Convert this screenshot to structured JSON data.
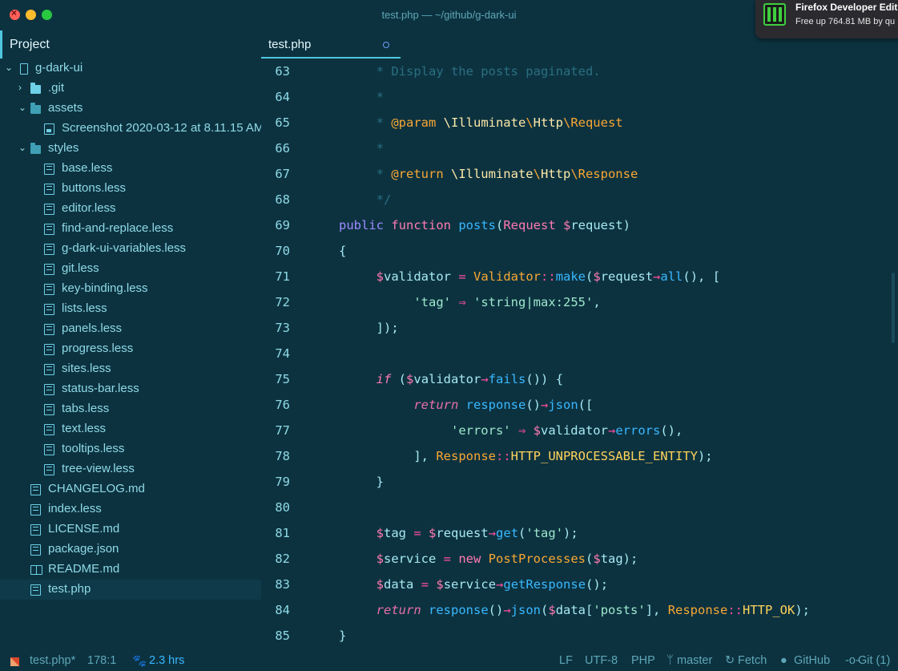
{
  "window": {
    "title": "test.php — ~/github/g-dark-ui"
  },
  "notification": {
    "title": "Firefox Developer Edit",
    "body": "Free up 764.81 MB by qu"
  },
  "sidebar": {
    "panel_title": "Project",
    "tree": [
      {
        "label": "g-dark-ui",
        "icon": "repo-icon",
        "arrow": "⌄",
        "depth": 0
      },
      {
        "label": ".git",
        "icon": "folder-icon",
        "arrow": "›",
        "depth": 1
      },
      {
        "label": "assets",
        "icon": "folder-open-icon",
        "arrow": "⌄",
        "depth": 1
      },
      {
        "label": "Screenshot 2020-03-12 at 8.11.15 AM",
        "icon": "image-icon",
        "arrow": "",
        "depth": 2
      },
      {
        "label": "styles",
        "icon": "folder-open-icon",
        "arrow": "⌄",
        "depth": 1
      },
      {
        "label": "base.less",
        "icon": "file-icon",
        "arrow": "",
        "depth": 2
      },
      {
        "label": "buttons.less",
        "icon": "file-icon",
        "arrow": "",
        "depth": 2
      },
      {
        "label": "editor.less",
        "icon": "file-icon",
        "arrow": "",
        "depth": 2
      },
      {
        "label": "find-and-replace.less",
        "icon": "file-icon",
        "arrow": "",
        "depth": 2
      },
      {
        "label": "g-dark-ui-variables.less",
        "icon": "file-icon",
        "arrow": "",
        "depth": 2
      },
      {
        "label": "git.less",
        "icon": "file-icon",
        "arrow": "",
        "depth": 2
      },
      {
        "label": "key-binding.less",
        "icon": "file-icon",
        "arrow": "",
        "depth": 2
      },
      {
        "label": "lists.less",
        "icon": "file-icon",
        "arrow": "",
        "depth": 2
      },
      {
        "label": "panels.less",
        "icon": "file-icon",
        "arrow": "",
        "depth": 2
      },
      {
        "label": "progress.less",
        "icon": "file-icon",
        "arrow": "",
        "depth": 2
      },
      {
        "label": "sites.less",
        "icon": "file-icon",
        "arrow": "",
        "depth": 2
      },
      {
        "label": "status-bar.less",
        "icon": "file-icon",
        "arrow": "",
        "depth": 2
      },
      {
        "label": "tabs.less",
        "icon": "file-icon",
        "arrow": "",
        "depth": 2
      },
      {
        "label": "text.less",
        "icon": "file-icon",
        "arrow": "",
        "depth": 2
      },
      {
        "label": "tooltips.less",
        "icon": "file-icon",
        "arrow": "",
        "depth": 2
      },
      {
        "label": "tree-view.less",
        "icon": "file-icon",
        "arrow": "",
        "depth": 2
      },
      {
        "label": "CHANGELOG.md",
        "icon": "file-icon",
        "arrow": "",
        "depth": 1
      },
      {
        "label": "index.less",
        "icon": "file-icon",
        "arrow": "",
        "depth": 1
      },
      {
        "label": "LICENSE.md",
        "icon": "file-icon",
        "arrow": "",
        "depth": 1
      },
      {
        "label": "package.json",
        "icon": "file-icon",
        "arrow": "",
        "depth": 1
      },
      {
        "label": "README.md",
        "icon": "book-icon",
        "arrow": "",
        "depth": 1
      },
      {
        "label": "test.php",
        "icon": "file-icon",
        "arrow": "",
        "depth": 1,
        "selected": true
      }
    ]
  },
  "tabs": [
    {
      "label": "test.php",
      "modified": true
    }
  ],
  "editor": {
    "lines": [
      {
        "n": "63",
        "tokens": [
          [
            "c-com",
            "     * Display the posts paginated."
          ]
        ]
      },
      {
        "n": "64",
        "tokens": [
          [
            "c-com",
            "     *"
          ]
        ]
      },
      {
        "n": "65",
        "tokens": [
          [
            "c-com",
            "     * "
          ],
          [
            "c-ann",
            "@param "
          ],
          [
            "c-ns",
            "\\Illuminate"
          ],
          [
            "c-cls",
            "\\"
          ],
          [
            "c-ns",
            "Http"
          ],
          [
            "c-cls",
            "\\Request"
          ]
        ]
      },
      {
        "n": "66",
        "tokens": [
          [
            "c-com",
            "     *"
          ]
        ]
      },
      {
        "n": "67",
        "tokens": [
          [
            "c-com",
            "     * "
          ],
          [
            "c-ann",
            "@return "
          ],
          [
            "c-ns",
            "\\Illuminate"
          ],
          [
            "c-cls",
            "\\"
          ],
          [
            "c-ns",
            "Http"
          ],
          [
            "c-cls",
            "\\Response"
          ]
        ]
      },
      {
        "n": "68",
        "tokens": [
          [
            "c-com",
            "     */"
          ]
        ]
      },
      {
        "n": "69",
        "tokens": [
          [
            "c-pub",
            "public "
          ],
          [
            "c-kw",
            "function "
          ],
          [
            "c-fn",
            "posts"
          ],
          [
            "c-txt",
            "("
          ],
          [
            "c-kw",
            "Request "
          ],
          [
            "c-var",
            "$"
          ],
          [
            "c-txt",
            "request)"
          ]
        ]
      },
      {
        "n": "70",
        "tokens": [
          [
            "c-txt",
            "{"
          ]
        ]
      },
      {
        "n": "71",
        "tokens": [
          [
            "c-txt",
            "     "
          ],
          [
            "c-var",
            "$"
          ],
          [
            "c-txt",
            "validator "
          ],
          [
            "c-op",
            "= "
          ],
          [
            "c-cls",
            "Validator"
          ],
          [
            "c-op",
            "::"
          ],
          [
            "c-fn",
            "make"
          ],
          [
            "c-txt",
            "("
          ],
          [
            "c-var",
            "$"
          ],
          [
            "c-txt",
            "request"
          ],
          [
            "c-op",
            "→"
          ],
          [
            "c-fn",
            "all"
          ],
          [
            "c-txt",
            "(), ["
          ]
        ]
      },
      {
        "n": "72",
        "tokens": [
          [
            "c-txt",
            "          "
          ],
          [
            "c-str",
            "'tag'"
          ],
          [
            "c-op",
            " ⇒ "
          ],
          [
            "c-str",
            "'string|max:255'"
          ],
          [
            "c-txt",
            ","
          ]
        ]
      },
      {
        "n": "73",
        "tokens": [
          [
            "c-txt",
            "     ]);"
          ]
        ]
      },
      {
        "n": "74",
        "tokens": []
      },
      {
        "n": "75",
        "tokens": [
          [
            "c-txt",
            "     "
          ],
          [
            "c-kw c-ital",
            "if "
          ],
          [
            "c-txt",
            "("
          ],
          [
            "c-var",
            "$"
          ],
          [
            "c-txt",
            "validator"
          ],
          [
            "c-op",
            "→"
          ],
          [
            "c-fn",
            "fails"
          ],
          [
            "c-txt",
            "()) {"
          ]
        ]
      },
      {
        "n": "76",
        "tokens": [
          [
            "c-txt",
            "          "
          ],
          [
            "c-kw2 c-ital",
            "return "
          ],
          [
            "c-fn",
            "response"
          ],
          [
            "c-txt",
            "()"
          ],
          [
            "c-op",
            "→"
          ],
          [
            "c-fn",
            "json"
          ],
          [
            "c-txt",
            "(["
          ]
        ]
      },
      {
        "n": "77",
        "tokens": [
          [
            "c-txt",
            "               "
          ],
          [
            "c-str",
            "'errors'"
          ],
          [
            "c-op",
            " ⇒ "
          ],
          [
            "c-var",
            "$"
          ],
          [
            "c-txt",
            "validator"
          ],
          [
            "c-op",
            "→"
          ],
          [
            "c-fn",
            "errors"
          ],
          [
            "c-txt",
            "(),"
          ]
        ]
      },
      {
        "n": "78",
        "tokens": [
          [
            "c-txt",
            "          ], "
          ],
          [
            "c-cls",
            "Response"
          ],
          [
            "c-op",
            "::"
          ],
          [
            "c-yel",
            "HTTP_UNPROCESSABLE_ENTITY"
          ],
          [
            "c-txt",
            ");"
          ]
        ]
      },
      {
        "n": "79",
        "tokens": [
          [
            "c-txt",
            "     }"
          ]
        ]
      },
      {
        "n": "80",
        "tokens": []
      },
      {
        "n": "81",
        "tokens": [
          [
            "c-txt",
            "     "
          ],
          [
            "c-var",
            "$"
          ],
          [
            "c-txt",
            "tag "
          ],
          [
            "c-op",
            "= "
          ],
          [
            "c-var",
            "$"
          ],
          [
            "c-txt",
            "request"
          ],
          [
            "c-op",
            "→"
          ],
          [
            "c-fn",
            "get"
          ],
          [
            "c-txt",
            "("
          ],
          [
            "c-str",
            "'tag'"
          ],
          [
            "c-txt",
            ");"
          ]
        ]
      },
      {
        "n": "82",
        "tokens": [
          [
            "c-txt",
            "     "
          ],
          [
            "c-var",
            "$"
          ],
          [
            "c-txt",
            "service "
          ],
          [
            "c-op",
            "= "
          ],
          [
            "c-kw",
            "new "
          ],
          [
            "c-cls",
            "PostProcesses"
          ],
          [
            "c-txt",
            "("
          ],
          [
            "c-var",
            "$"
          ],
          [
            "c-txt",
            "tag);"
          ]
        ]
      },
      {
        "n": "83",
        "tokens": [
          [
            "c-txt",
            "     "
          ],
          [
            "c-var",
            "$"
          ],
          [
            "c-txt",
            "data "
          ],
          [
            "c-op",
            "= "
          ],
          [
            "c-var",
            "$"
          ],
          [
            "c-txt",
            "service"
          ],
          [
            "c-op",
            "→"
          ],
          [
            "c-fn",
            "getResponse"
          ],
          [
            "c-txt",
            "();"
          ]
        ]
      },
      {
        "n": "84",
        "tokens": [
          [
            "c-txt",
            "     "
          ],
          [
            "c-kw2 c-ital",
            "return "
          ],
          [
            "c-fn",
            "response"
          ],
          [
            "c-txt",
            "()"
          ],
          [
            "c-op",
            "→"
          ],
          [
            "c-fn",
            "json"
          ],
          [
            "c-txt",
            "("
          ],
          [
            "c-var",
            "$"
          ],
          [
            "c-txt",
            "data["
          ],
          [
            "c-str",
            "'posts'"
          ],
          [
            "c-txt",
            "], "
          ],
          [
            "c-cls",
            "Response"
          ],
          [
            "c-op",
            "::"
          ],
          [
            "c-yel",
            "HTTP_OK"
          ],
          [
            "c-txt",
            ");"
          ]
        ]
      },
      {
        "n": "85",
        "tokens": [
          [
            "c-txt",
            "}"
          ]
        ]
      }
    ]
  },
  "statusbar": {
    "file": "test.php*",
    "cursor": "178:1",
    "time": "2.3 hrs",
    "line_ending": "LF",
    "encoding": "UTF-8",
    "grammar": "PHP",
    "branch": "master",
    "fetch": "Fetch",
    "github": "GitHub",
    "git": "Git (1)"
  },
  "colors": {
    "background": "#0c3240",
    "accent": "#4fc6de",
    "text": "#8fdae6"
  }
}
